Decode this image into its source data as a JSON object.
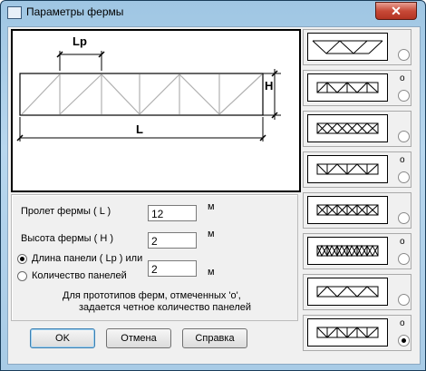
{
  "window": {
    "title": "Параметры фермы",
    "close_label": "✕"
  },
  "drawing": {
    "panel_label": "Lp",
    "height_label": "H",
    "span_label": "L"
  },
  "fields": {
    "span_label": "Пролет фермы  ( L )",
    "span_value": "12",
    "span_unit": "м",
    "height_label": "Высота фермы  ( H )",
    "height_value": "2",
    "height_unit": "м",
    "option_panel_length": "Длина панели ( Lp ) или",
    "option_panel_count": "Количество панелей",
    "panel_value": "2",
    "panel_unit": "м",
    "selected_option": "panel_length"
  },
  "note": {
    "line1": "Для прототипов ферм, отмеченных 'о',",
    "line2": "задается четное количество панелей"
  },
  "buttons": {
    "ok": "OK",
    "cancel": "Отмена",
    "help": "Справка"
  },
  "prototypes": [
    {
      "mark": "",
      "selected": false
    },
    {
      "mark": "о",
      "selected": false
    },
    {
      "mark": "",
      "selected": false
    },
    {
      "mark": "о",
      "selected": false
    },
    {
      "mark": "",
      "selected": false
    },
    {
      "mark": "о",
      "selected": false
    },
    {
      "mark": "",
      "selected": false
    },
    {
      "mark": "о",
      "selected": true
    }
  ],
  "selected_prototype": 8
}
